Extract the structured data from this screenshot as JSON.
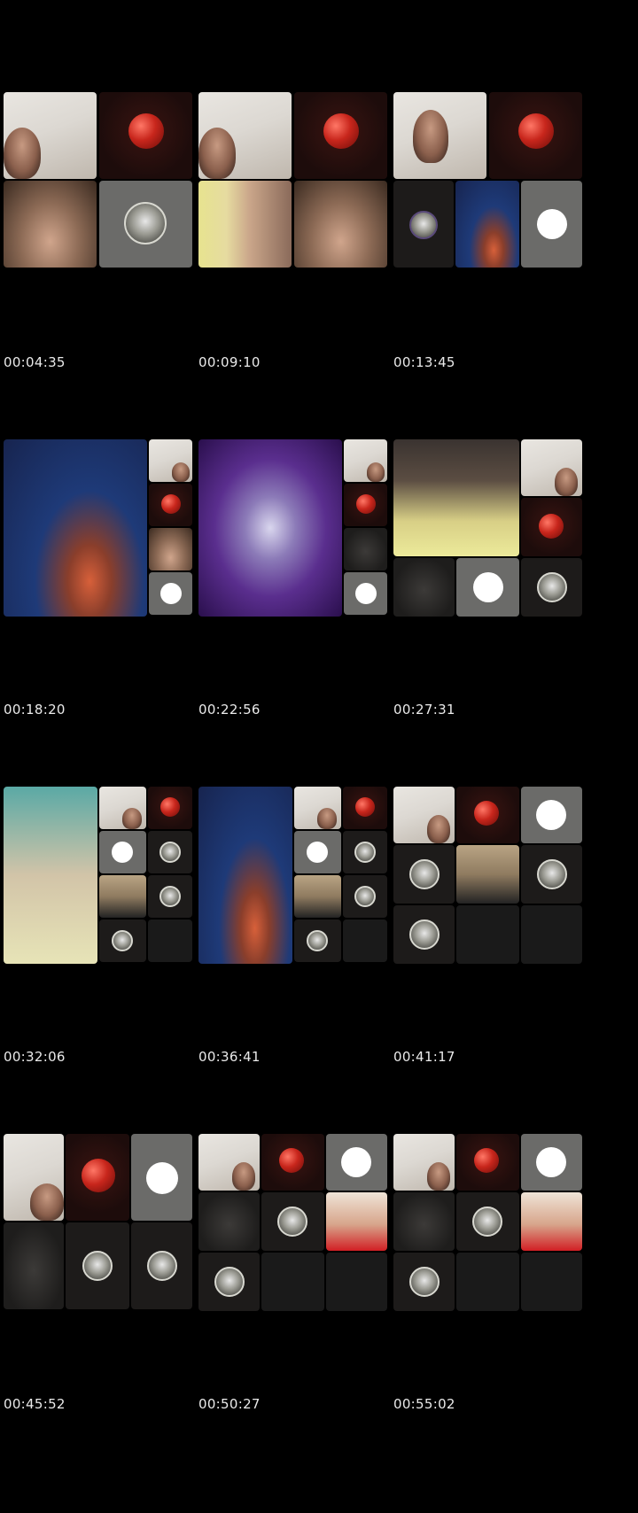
{
  "timestamps": [
    "00:04:35",
    "00:09:10",
    "00:13:45",
    "00:18:20",
    "00:22:56",
    "00:27:31",
    "00:32:06",
    "00:36:41",
    "00:41:17",
    "00:45:52",
    "00:50:27",
    "00:55:02"
  ]
}
